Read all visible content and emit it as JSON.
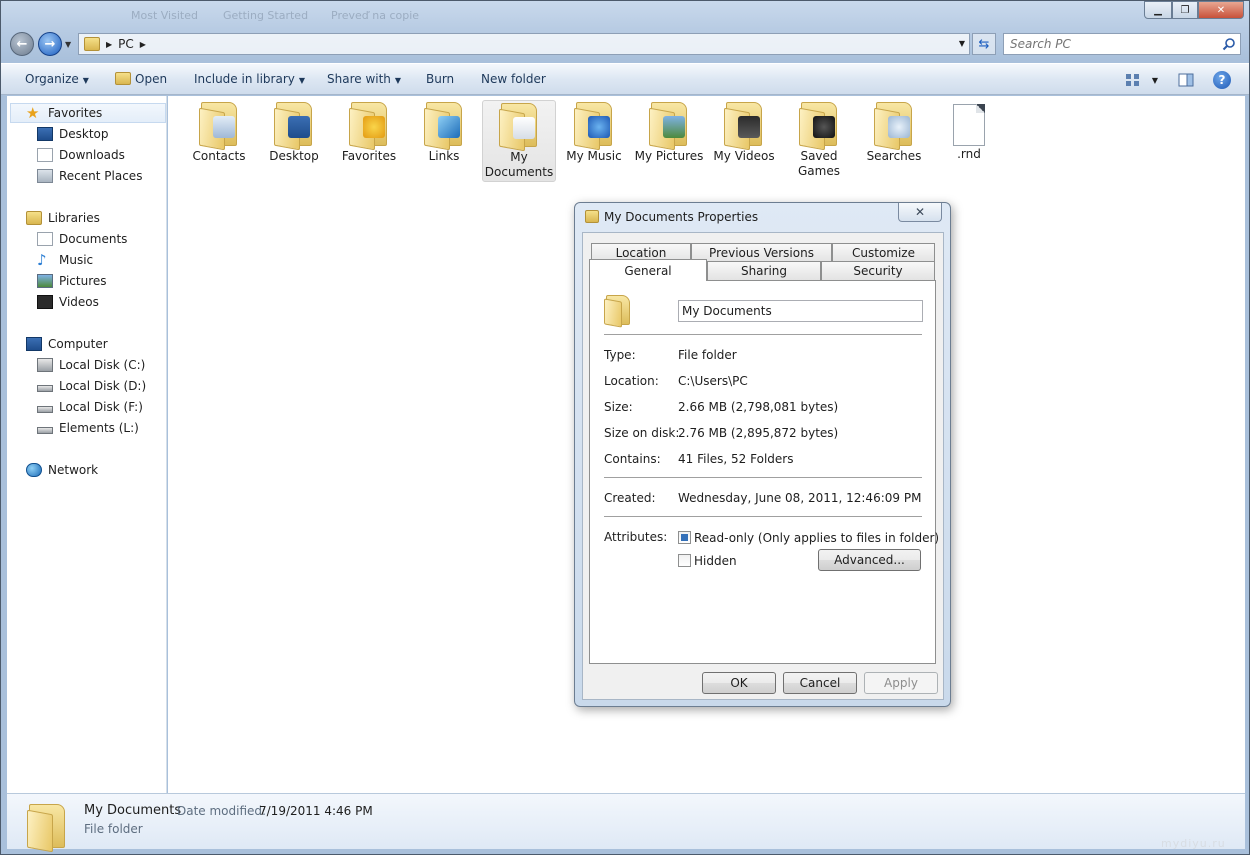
{
  "window": {
    "ghost_tabs": [
      "Most Visited",
      "Getting Started",
      "Preveď na copie"
    ]
  },
  "address": {
    "path": "PC",
    "search_placeholder": "Search PC"
  },
  "toolbar": {
    "organize": "Organize",
    "open": "Open",
    "include_in_library": "Include in library",
    "share_with": "Share with",
    "burn": "Burn",
    "new_folder": "New folder"
  },
  "sidebar": {
    "favorites": {
      "label": "Favorites",
      "items": [
        "Desktop",
        "Downloads",
        "Recent Places"
      ]
    },
    "libraries": {
      "label": "Libraries",
      "items": [
        "Documents",
        "Music",
        "Pictures",
        "Videos"
      ]
    },
    "computer": {
      "label": "Computer",
      "items": [
        "Local Disk (C:)",
        "Local Disk (D:)",
        "Local Disk (F:)",
        "Elements (L:)"
      ]
    },
    "network": {
      "label": "Network"
    }
  },
  "files": [
    {
      "name": "Contacts",
      "icon": "contacts-folder-icon"
    },
    {
      "name": "Desktop",
      "icon": "desktop-folder-icon"
    },
    {
      "name": "Favorites",
      "icon": "favorites-folder-icon"
    },
    {
      "name": "Links",
      "icon": "links-folder-icon"
    },
    {
      "name": "My Documents",
      "icon": "documents-folder-icon",
      "selected": true
    },
    {
      "name": "My Music",
      "icon": "music-folder-icon"
    },
    {
      "name": "My Pictures",
      "icon": "pictures-folder-icon"
    },
    {
      "name": "My Videos",
      "icon": "videos-folder-icon"
    },
    {
      "name": "Saved Games",
      "icon": "games-folder-icon"
    },
    {
      "name": "Searches",
      "icon": "searches-folder-icon"
    },
    {
      "name": ".rnd",
      "icon": "file-icon"
    }
  ],
  "details": {
    "name": "My Documents",
    "date_label": "Date modified:",
    "date_value": "7/19/2011 4:46 PM",
    "type": "File folder"
  },
  "watermark": "mydiyu.ru",
  "dialog": {
    "title": "My Documents Properties",
    "close": "✕",
    "tabs_row1": [
      "Location",
      "Previous Versions",
      "Customize"
    ],
    "tabs_row2": [
      "General",
      "Sharing",
      "Security"
    ],
    "active_tab": "General",
    "folder_name": "My Documents",
    "props": [
      {
        "label": "Type:",
        "value": "File folder"
      },
      {
        "label": "Location:",
        "value": "C:\\Users\\PC"
      },
      {
        "label": "Size:",
        "value": "2.66 MB (2,798,081 bytes)"
      },
      {
        "label": "Size on disk:",
        "value": "2.76 MB (2,895,872 bytes)"
      },
      {
        "label": "Contains:",
        "value": "41 Files, 52 Folders"
      }
    ],
    "created_label": "Created:",
    "created_value": "Wednesday, June 08, 2011, 12:46:09 PM",
    "attributes_label": "Attributes:",
    "readonly_label": "Read-only (Only applies to files in folder)",
    "hidden_label": "Hidden",
    "advanced_label": "Advanced...",
    "ok_label": "OK",
    "cancel_label": "Cancel",
    "apply_label": "Apply"
  },
  "colors": {
    "accent": "#1a5cbf",
    "folder": "#ddbd5b",
    "checkbox_fill": "#3470b8"
  }
}
